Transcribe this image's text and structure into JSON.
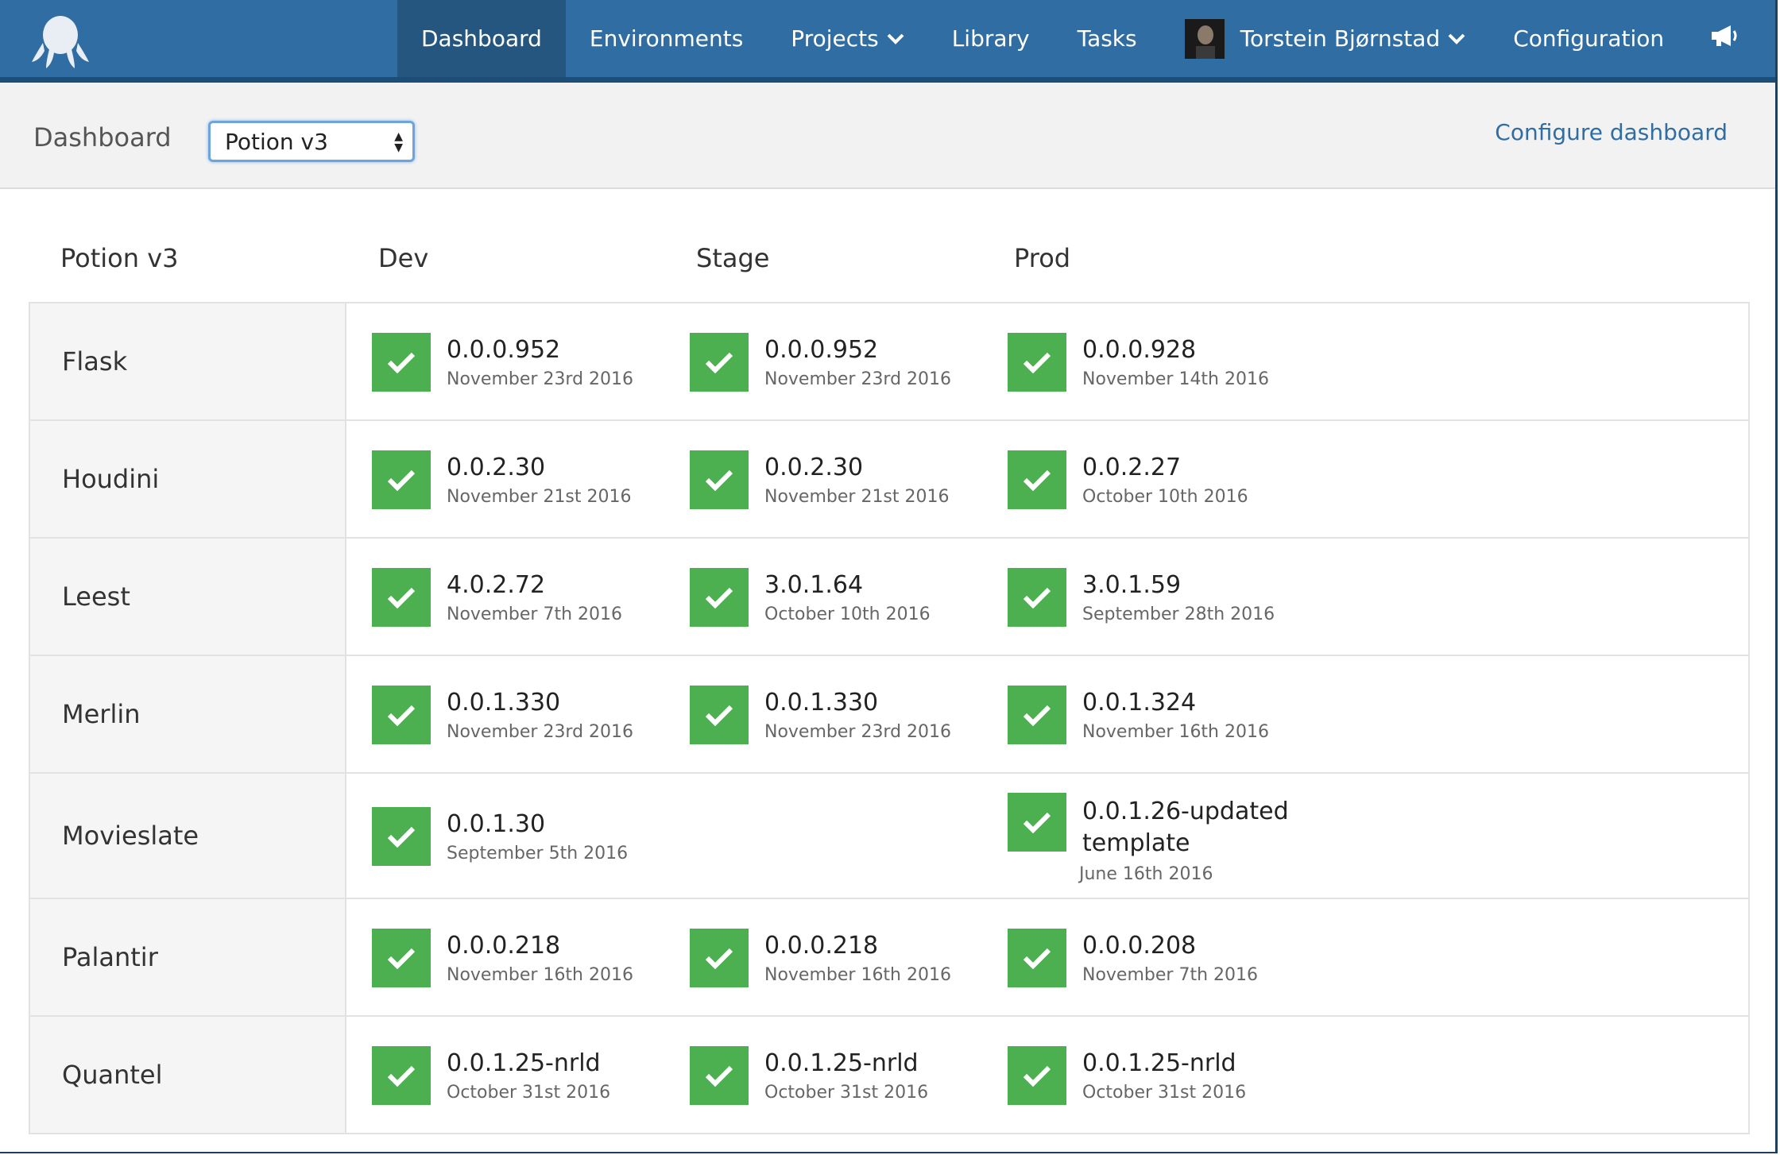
{
  "nav": {
    "items": [
      {
        "label": "Dashboard",
        "active": true
      },
      {
        "label": "Environments"
      },
      {
        "label": "Projects",
        "dropdown": true
      },
      {
        "label": "Library"
      },
      {
        "label": "Tasks"
      }
    ],
    "user": {
      "name": "Torstein Bjørnstad"
    },
    "configuration": "Configuration"
  },
  "subheader": {
    "title": "Dashboard",
    "select_value": "Potion v3",
    "configure_link": "Configure dashboard"
  },
  "table": {
    "group_label": "Potion v3",
    "environments": [
      "Dev",
      "Stage",
      "Prod"
    ],
    "rows": [
      {
        "name": "Flask",
        "cells": [
          {
            "version": "0.0.0.952",
            "date": "November 23rd 2016"
          },
          {
            "version": "0.0.0.952",
            "date": "November 23rd 2016"
          },
          {
            "version": "0.0.0.928",
            "date": "November 14th 2016"
          }
        ]
      },
      {
        "name": "Houdini",
        "cells": [
          {
            "version": "0.0.2.30",
            "date": "November 21st 2016"
          },
          {
            "version": "0.0.2.30",
            "date": "November 21st 2016"
          },
          {
            "version": "0.0.2.27",
            "date": "October 10th 2016"
          }
        ]
      },
      {
        "name": "Leest",
        "cells": [
          {
            "version": "4.0.2.72",
            "date": "November 7th 2016"
          },
          {
            "version": "3.0.1.64",
            "date": "October 10th 2016"
          },
          {
            "version": "3.0.1.59",
            "date": "September 28th 2016"
          }
        ]
      },
      {
        "name": "Merlin",
        "cells": [
          {
            "version": "0.0.1.330",
            "date": "November 23rd 2016"
          },
          {
            "version": "0.0.1.330",
            "date": "November 23rd 2016"
          },
          {
            "version": "0.0.1.324",
            "date": "November 16th 2016"
          }
        ]
      },
      {
        "name": "Movieslate",
        "cells": [
          {
            "version": "0.0.1.30",
            "date": "September 5th 2016"
          },
          null,
          {
            "version": "0.0.1.26-updatedtemplate",
            "date": "June 16th 2016"
          }
        ]
      },
      {
        "name": "Palantir",
        "cells": [
          {
            "version": "0.0.0.218",
            "date": "November 16th 2016"
          },
          {
            "version": "0.0.0.218",
            "date": "November 16th 2016"
          },
          {
            "version": "0.0.0.208",
            "date": "November 7th 2016"
          }
        ]
      },
      {
        "name": "Quantel",
        "cells": [
          {
            "version": "0.0.1.25-nrld",
            "date": "October 31st 2016"
          },
          {
            "version": "0.0.1.25-nrld",
            "date": "October 31st 2016"
          },
          {
            "version": "0.0.1.25-nrld",
            "date": "October 31st 2016"
          }
        ]
      }
    ]
  },
  "colors": {
    "nav_bg": "#2f6da3",
    "nav_active": "#24567f",
    "success": "#4caf50",
    "link": "#2f6da3"
  }
}
